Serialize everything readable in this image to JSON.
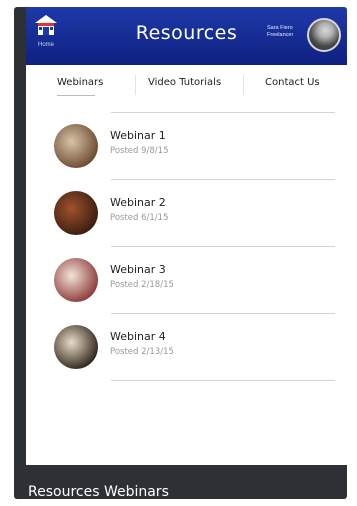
{
  "header": {
    "title": "Resources",
    "home_label": "Home",
    "user_name": "Sara Fiero Freelancer"
  },
  "tabs": [
    {
      "label": "Webinars",
      "selected": true
    },
    {
      "label": "Video Tutorials",
      "selected": false
    },
    {
      "label": "Contact Us",
      "selected": false
    }
  ],
  "webinars": [
    {
      "title": "Webinar 1",
      "posted": "Posted 9/8/15",
      "thumb_colors": [
        "#d8c4a8",
        "#6b4a30"
      ]
    },
    {
      "title": "Webinar 2",
      "posted": "Posted 6/1/15",
      "thumb_colors": [
        "#a0522d",
        "#3a1c10"
      ]
    },
    {
      "title": "Webinar 3",
      "posted": "Posted 2/18/15",
      "thumb_colors": [
        "#f3e4d8",
        "#8c3a3a"
      ]
    },
    {
      "title": "Webinar 4",
      "posted": "Posted 2/13/15",
      "thumb_colors": [
        "#e9dcc8",
        "#2f241b"
      ]
    }
  ],
  "caption": "Resources Webinars",
  "colors": {
    "header_top": "#1e39a9",
    "header_bottom": "#0f2180",
    "frame": "#2d3136"
  }
}
